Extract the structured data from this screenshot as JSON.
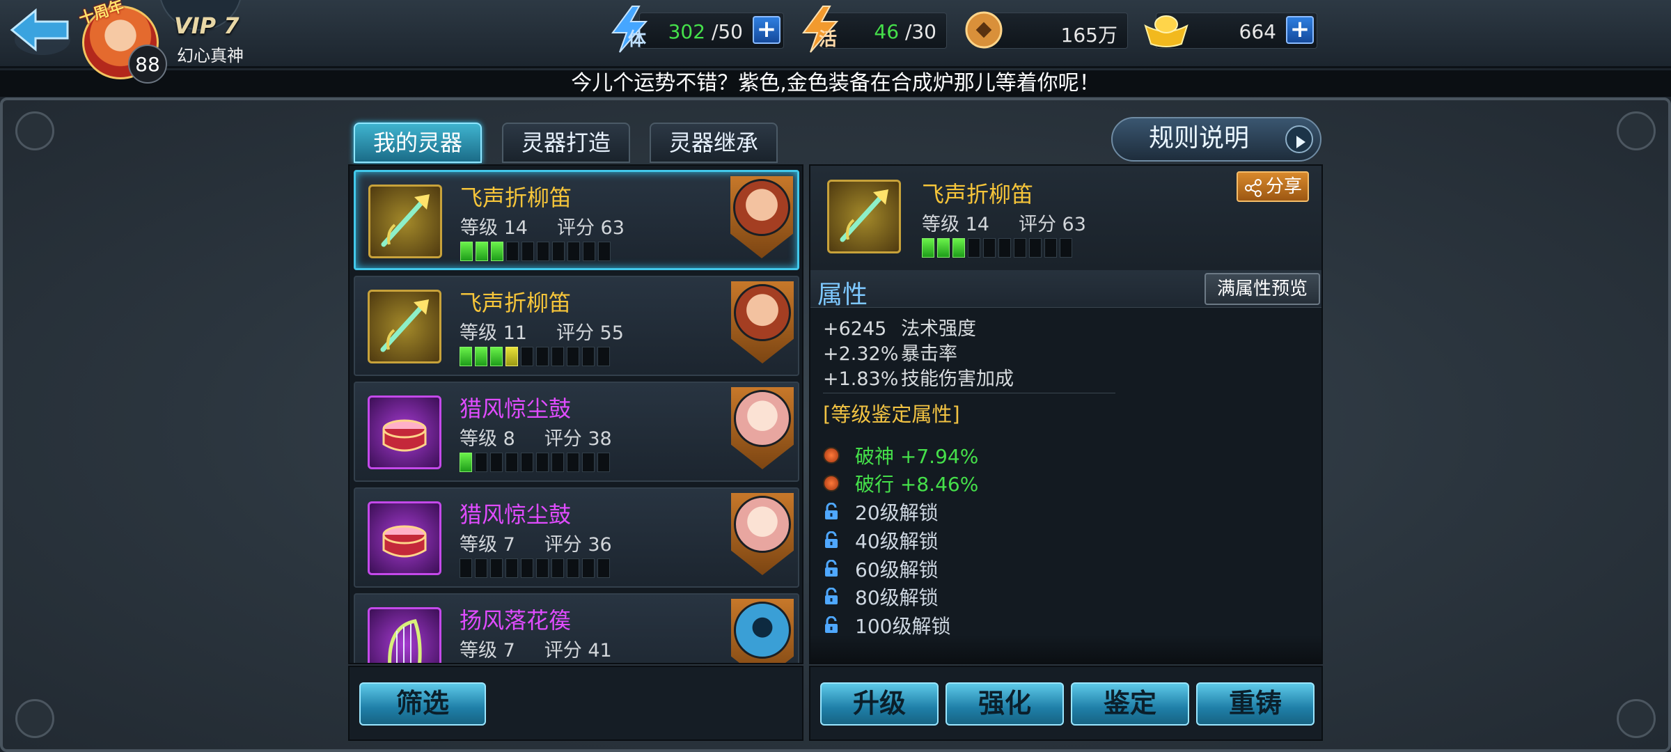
{
  "player": {
    "avatar_badge": "十周年",
    "level": "88",
    "vip": "VIP 7",
    "name": "幻心真神"
  },
  "resources": {
    "stamina": {
      "icon_label": "体",
      "current": "302",
      "max": "/50"
    },
    "vitality": {
      "icon_label": "活",
      "current": "46",
      "max": "/30"
    },
    "coins": {
      "value": "165万"
    },
    "gold": {
      "value": "664"
    }
  },
  "marquee": "今儿个运势不错？紫色,金色装备在合成炉那儿等着你呢！",
  "tabs": [
    "我的灵器",
    "灵器打造",
    "灵器继承"
  ],
  "active_tab": 0,
  "rules_button": "规则说明",
  "items": [
    {
      "name": "飞声折柳笛",
      "level_label": "等级 14",
      "score_label": "评分 63",
      "quality": "gold",
      "pips": 3,
      "pips_yellow": 0,
      "selected": true
    },
    {
      "name": "飞声折柳笛",
      "level_label": "等级 11",
      "score_label": "评分 55",
      "quality": "gold",
      "pips": 3,
      "pips_yellow": 1,
      "selected": false
    },
    {
      "name": "猎风惊尘鼓",
      "level_label": "等级 8",
      "score_label": "评分 38",
      "quality": "purple",
      "pips": 1,
      "pips_yellow": 0,
      "selected": false
    },
    {
      "name": "猎风惊尘鼓",
      "level_label": "等级 7",
      "score_label": "评分 36",
      "quality": "purple",
      "pips": 0,
      "pips_yellow": 0,
      "selected": false
    },
    {
      "name": "扬风落花篌",
      "level_label": "等级 7",
      "score_label": "评分 41",
      "quality": "purple",
      "pips": 0,
      "pips_yellow": 0,
      "selected": false
    }
  ],
  "filter_button": "筛选",
  "detail": {
    "name": "飞声折柳笛",
    "level_label": "等级 14",
    "score_label": "评分 63",
    "pips": 3,
    "share_button": "分享",
    "attributes_title": "属性",
    "full_preview_button": "满属性预览",
    "attributes": [
      {
        "value": "+6245",
        "name": "法术强度"
      },
      {
        "value": "+2.32%",
        "name": "暴击率"
      },
      {
        "value": "+1.83%",
        "name": "技能伤害加成"
      }
    ],
    "appraisal_title": "[等级鉴定属性]",
    "appraisal": [
      {
        "text": "破神 +7.94%",
        "unlocked": true
      },
      {
        "text": "破行 +8.46%",
        "unlocked": true
      },
      {
        "text": "20级解锁",
        "unlocked": false
      },
      {
        "text": "40级解锁",
        "unlocked": false
      },
      {
        "text": "60级解锁",
        "unlocked": false
      },
      {
        "text": "80级解锁",
        "unlocked": false
      },
      {
        "text": "100级解锁",
        "unlocked": false
      }
    ]
  },
  "actions": [
    "升级",
    "强化",
    "鉴定",
    "重铸"
  ],
  "colors": {
    "accent_teal": "#42c8ea",
    "gold_quality": "#f6c53a",
    "purple_quality": "#e04cff",
    "green_stat": "#45e04a"
  }
}
